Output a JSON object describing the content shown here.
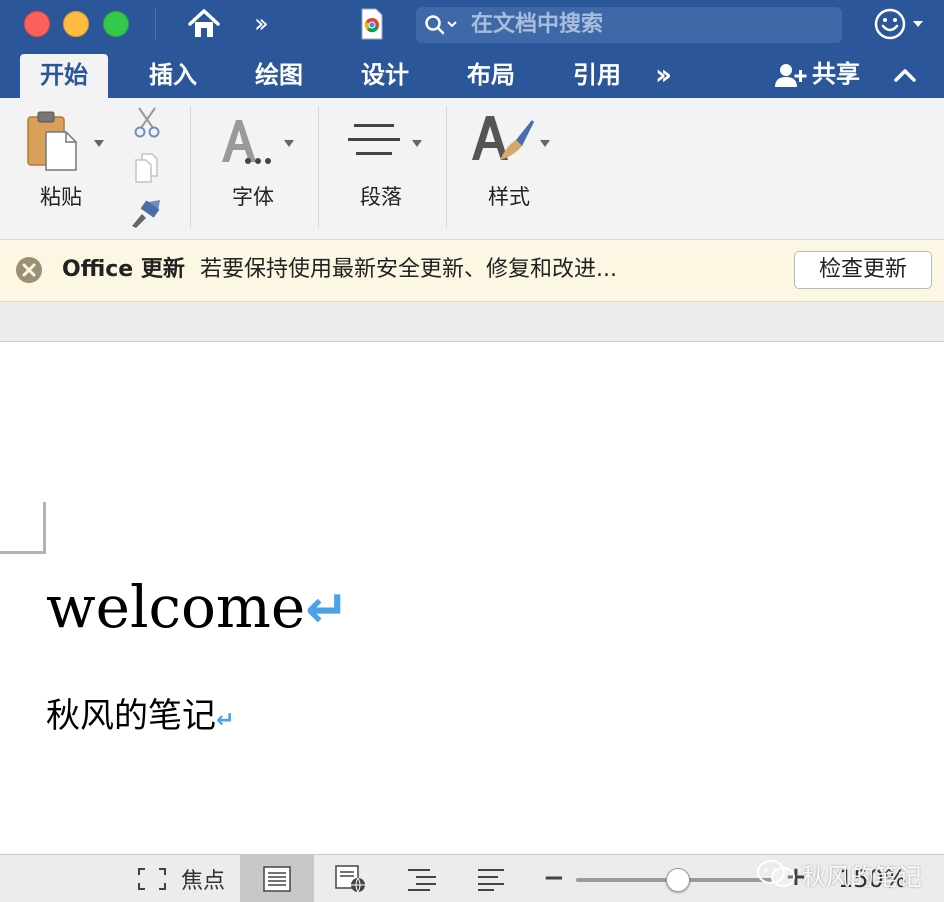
{
  "titlebar": {
    "search_placeholder": "在文档中搜索"
  },
  "tabs": [
    {
      "label": "开始"
    },
    {
      "label": "插入"
    },
    {
      "label": "绘图"
    },
    {
      "label": "设计"
    },
    {
      "label": "布局"
    },
    {
      "label": "引用"
    }
  ],
  "share_label": "共享",
  "ribbon": {
    "paste_label": "粘贴",
    "font_label": "字体",
    "paragraph_label": "段落",
    "styles_label": "样式"
  },
  "banner": {
    "title": "Office 更新",
    "message": "若要保持使用最新安全更新、修复和改进...",
    "button": "检查更新"
  },
  "document": {
    "line1": "welcome",
    "line2": "秋风的笔记",
    "paragraph_mark": "↵"
  },
  "statusbar": {
    "focus_label": "焦点",
    "zoom_level": "150%",
    "zoom_fraction": 0.52
  },
  "watermark": "秋风的笔记",
  "colors": {
    "accent": "#2b579a",
    "paragraph_mark": "#4aa3e8",
    "banner_bg": "#fcf7e3"
  }
}
